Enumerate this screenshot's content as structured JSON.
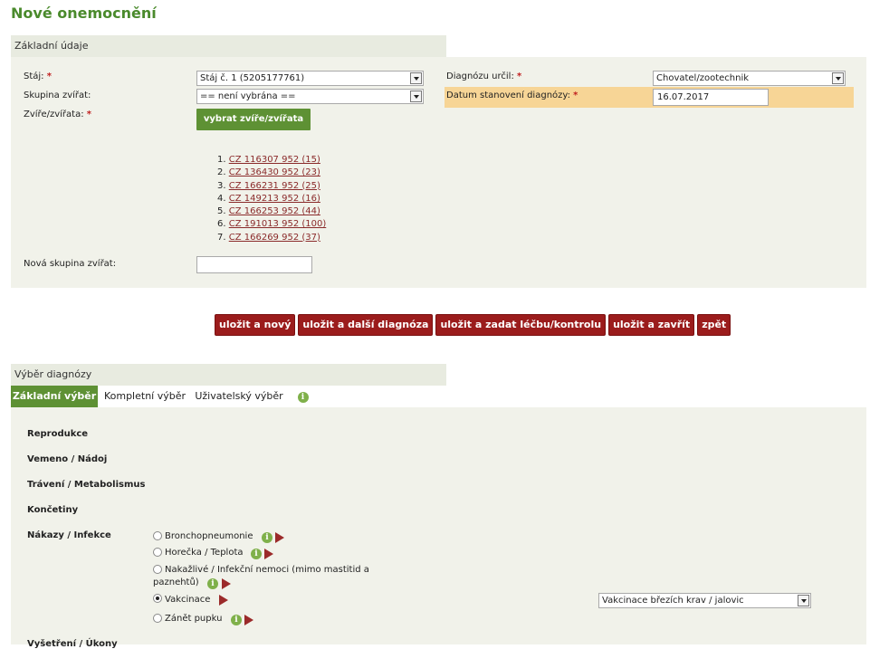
{
  "page": {
    "title": "Nové onemocnění"
  },
  "basic": {
    "header": "Základní údaje",
    "stable_label": "Stáj:",
    "stable_value": "Stáj č. 1 (5205177761)",
    "group_label": "Skupina zvířat:",
    "group_value": "== není vybrána ==",
    "animals_label": "Zvíře/zvířata:",
    "select_animals_button": "vybrat zvíře/zvířata",
    "diagnosed_by_label": "Diagnózu určil:",
    "diagnosed_by_value": "Chovatel/zootechnik",
    "date_label": "Datum stanovení diagnózy:",
    "date_value": "16.07.2017",
    "new_group_label": "Nová skupina zvířat:",
    "new_group_value": "",
    "required_mark": "*",
    "animals": [
      {
        "num": "1.",
        "label": "CZ 116307 952 (15)"
      },
      {
        "num": "2.",
        "label": "CZ 136430 952 (23)"
      },
      {
        "num": "3.",
        "label": "CZ 166231 952 (25)"
      },
      {
        "num": "4.",
        "label": "CZ 149213 952 (16)"
      },
      {
        "num": "5.",
        "label": "CZ 166253 952 (44)"
      },
      {
        "num": "6.",
        "label": "CZ 191013 952 (100)"
      },
      {
        "num": "7.",
        "label": "CZ 166269 952 (37)"
      }
    ]
  },
  "actions": {
    "save_new": "uložit a nový",
    "save_next": "uložit a další diagnóza",
    "save_treatment": "uložit a zadat léčbu/kontrolu",
    "save_close": "uložit a zavřít",
    "back": "zpět"
  },
  "diagnosis": {
    "header": "Výběr diagnózy",
    "tabs": [
      "Základní výběr",
      "Kompletní výběr",
      "Uživatelský výběr"
    ],
    "info_glyph": "i",
    "categories": [
      "Reprodukce",
      "Vemeno / Nádoj",
      "Trávení / Metabolismus",
      "Končetiny",
      "Nákazy / Infekce",
      "Vyšetření / Úkony"
    ],
    "options": [
      "Bronchopneumonie",
      "Horečka / Teplota",
      "Nakažlivé / Infekční nemoci (mimo mastitid a paznehtů)",
      "Vakcinace",
      "Zánět pupku"
    ],
    "option_line2": "paznehtů)",
    "option_line1": "Nakažlivé / Infekční nemoci (mimo mastitid a",
    "vaccination_value": "Vakcinace březích krav / jalovic"
  },
  "colors": {
    "accent_green": "#5e9134",
    "action_red": "#9b1c1c",
    "highlight": "#f7d596"
  }
}
